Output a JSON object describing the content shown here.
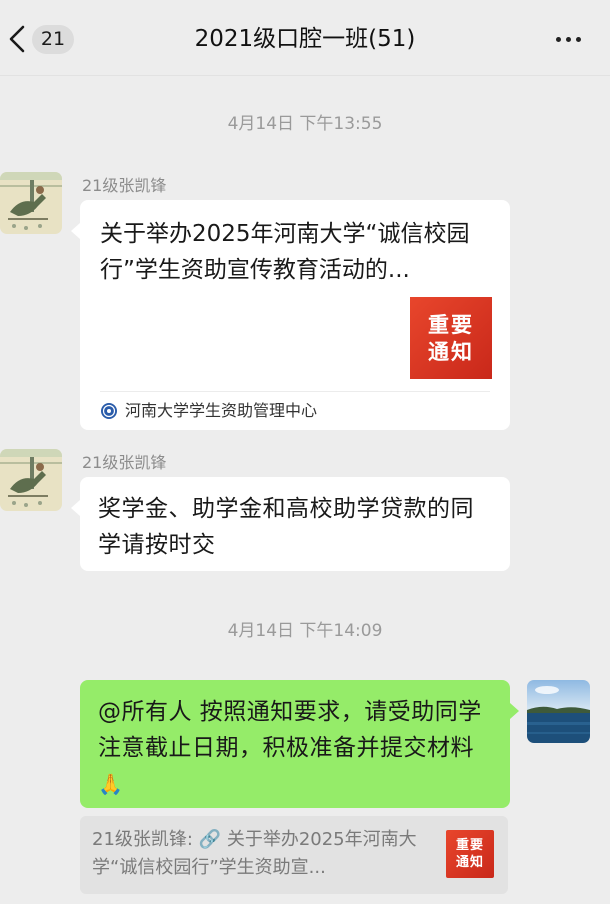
{
  "header": {
    "unread_count": "21",
    "title": "2021级口腔一班(51)"
  },
  "messages": {
    "time1": "4月14日 下午13:55",
    "time2": "4月14日 下午14:09",
    "sender": "21级张凯锋",
    "card": {
      "title": "关于举办2025年河南大学“诚信校园行”学生资助宣传教育活动的...",
      "thumb_line1": "重要",
      "thumb_line2": "通知",
      "source": "河南大学学生资助管理中心"
    },
    "text1": "奖学金、助学金和高校助学贷款的同学请按时交",
    "text2": "@所有人  按照通知要求，请受助同学注意截止日期，积极准备并提交材料",
    "text2_emoji": "🙏",
    "quote": {
      "text": "21级张凯锋: 🔗 关于举办2025年河南大学“诚信校园行”学生资助宣...",
      "thumb_line1": "重要",
      "thumb_line2": "通知"
    }
  },
  "colors": {
    "background": "#ededed",
    "bubble_in": "#ffffff",
    "bubble_out": "#95ec69",
    "notice_red": "#d9341f"
  }
}
